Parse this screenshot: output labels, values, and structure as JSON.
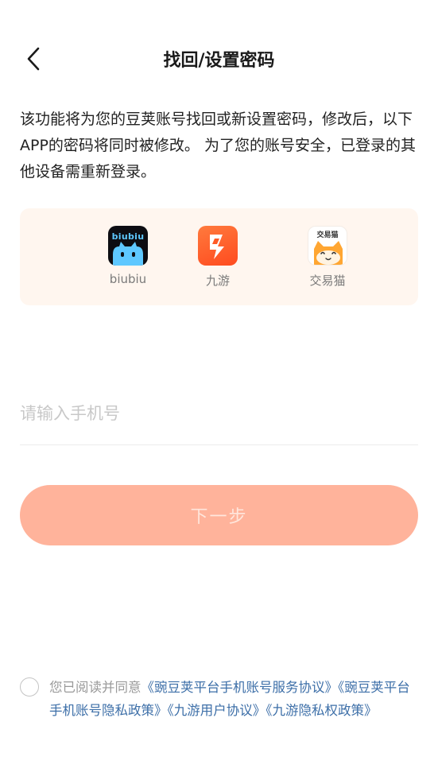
{
  "header": {
    "title": "找回/设置密码"
  },
  "description": "该功能将为您的豆荚账号找回或新设置密码，修改后，以下APP的密码将同时被修改。 为了您的账号安全，已登录的其他设备需重新登录。",
  "apps": [
    {
      "name": "biubiu",
      "icon_label": "biubiu",
      "icon": "biubiu-app-icon"
    },
    {
      "name": "九游",
      "icon_label": "",
      "icon": "jiuyou-app-icon"
    },
    {
      "name": "交易猫",
      "icon_label": "交易猫",
      "icon": "jiaoyimao-app-icon"
    }
  ],
  "phone": {
    "value": "",
    "placeholder": "请输入手机号"
  },
  "next_button": {
    "label": "下一步",
    "enabled": false
  },
  "agreement": {
    "checked": false,
    "prefix": "您已阅读并同意",
    "links": [
      "《豌豆荚平台手机账号服务协议》",
      "《豌豆荚平台手机账号隐私政策》",
      "《九游用户协议》",
      "《九游隐私权政策》"
    ]
  },
  "colors": {
    "accent_button": "#ffb39b",
    "link": "#3d6fa8",
    "card_bg": "#fff6ef"
  }
}
